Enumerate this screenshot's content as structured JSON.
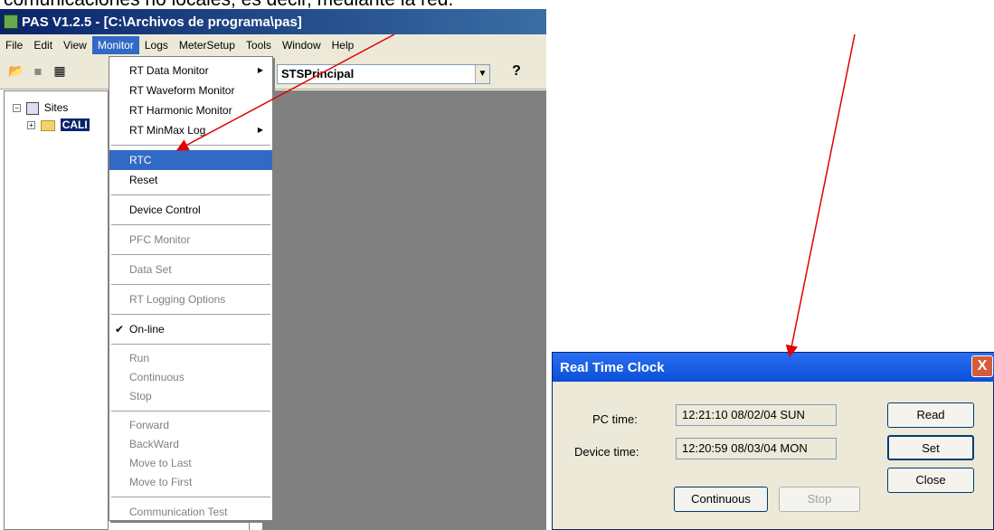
{
  "caption": "comunicaciones no locales, es decir, mediante la red.",
  "window": {
    "title": "PAS V1.2.5 - [C:\\Archivos de programa\\pas]"
  },
  "menubar": [
    "File",
    "Edit",
    "View",
    "Monitor",
    "Logs",
    "MeterSetup",
    "Tools",
    "Window",
    "Help"
  ],
  "toolbar": {
    "site_combo": "STSPrincipal",
    "help": "?"
  },
  "tree": {
    "root": "Sites",
    "child": "CALI"
  },
  "monitor_menu": {
    "g1": [
      "RT Data Monitor",
      "RT Waveform Monitor",
      "RT Harmonic Monitor",
      "RT MinMax Log"
    ],
    "rtc": "RTC",
    "reset": "Reset",
    "device_control": "Device Control",
    "pfc": "PFC Monitor",
    "data_set": "Data Set",
    "rt_logging": "RT Logging Options",
    "online": "On-line",
    "g2": [
      "Run",
      "Continuous",
      "Stop"
    ],
    "g3": [
      "Forward",
      "BackWard",
      "Move to Last",
      "Move to First"
    ],
    "comm_test": "Communication Test"
  },
  "dialog": {
    "title": "Real Time Clock",
    "close": "X",
    "pc_time_label": "PC time:",
    "pc_time_value": "12:21:10  08/02/04  SUN",
    "device_time_label": "Device time:",
    "device_time_value": "12:20:59  08/03/04  MON",
    "read_button": "Read",
    "set_button": "Set",
    "close_button": "Close",
    "continuous_button": "Continuous",
    "stop_button": "Stop"
  },
  "colors": {
    "selection": "#316ac5",
    "arrow": "#e00000",
    "dialog_title": "#0a4fd6"
  }
}
